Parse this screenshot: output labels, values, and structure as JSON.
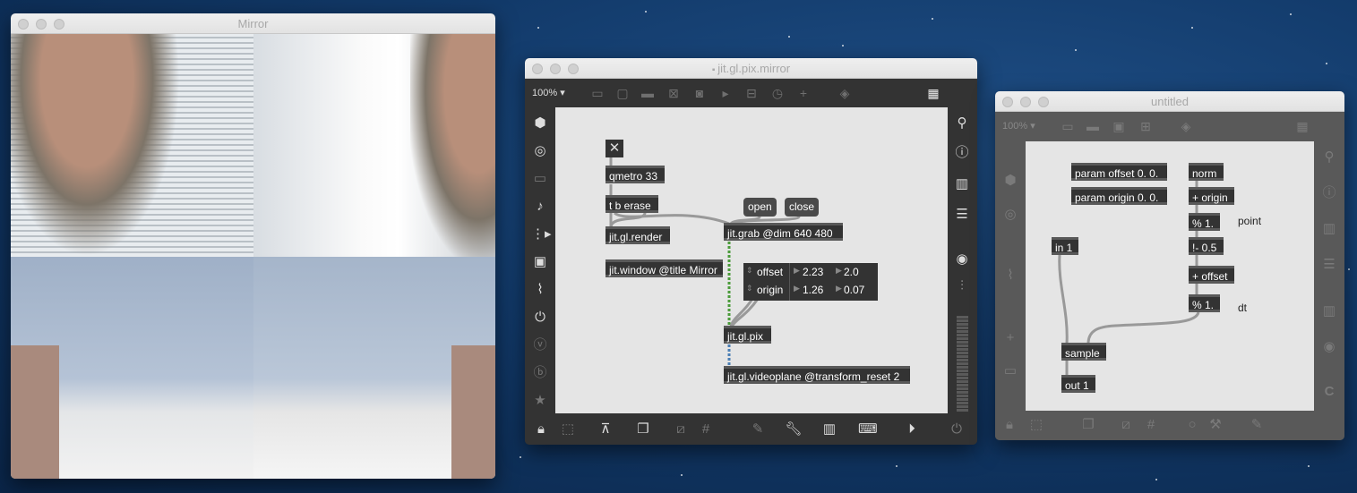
{
  "mirror_window": {
    "title": "Mirror"
  },
  "pix_window": {
    "title": "jit.gl.pix.mirror",
    "zoom": "100%",
    "toolbar_icons": [
      "presentation-icon",
      "message-icon",
      "comment-icon",
      "toggle-icon",
      "button-icon",
      "slider-icon",
      "number-icon",
      "dial-icon",
      "plus-icon",
      "paint-bucket-icon",
      "grid-icon"
    ],
    "objects": {
      "toggle": "✕",
      "qmetro": "qmetro 33",
      "trigger": "t b erase",
      "render": "jit.gl.render",
      "window": "jit.window @title Mirror",
      "open": "open",
      "close": "close",
      "grab": "jit.grab @dim 640 480",
      "pix": "jit.gl.pix",
      "videoplane": "jit.gl.videoplane @transform_reset 2"
    },
    "attrui": {
      "rows": [
        {
          "name": "offset",
          "v1": "2.23",
          "v2": "2.0"
        },
        {
          "name": "origin",
          "v1": "1.26",
          "v2": "0.07"
        }
      ]
    }
  },
  "gen_window": {
    "title": "untitled",
    "zoom": "100%",
    "objects": {
      "param_offset": "param offset 0. 0.",
      "param_origin": "param origin 0. 0.",
      "norm": "norm",
      "plus_origin": "+ origin",
      "mod1": "% 1.",
      "rsub": "!- 0.5",
      "plus_offset": "+ offset",
      "mod2": "% 1.",
      "in1": "in 1",
      "sample": "sample",
      "out1": "out 1"
    },
    "comments": {
      "point": "point",
      "dt": "dt"
    }
  },
  "colors": {
    "patcher_bg": "#e5e5e5",
    "object": "#333333",
    "chrome": "#333333",
    "gen_chrome": "#595959"
  }
}
